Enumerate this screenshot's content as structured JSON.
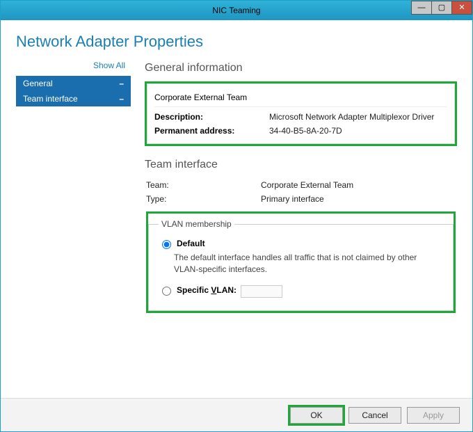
{
  "window": {
    "title": "NIC Teaming"
  },
  "page": {
    "title": "Network Adapter Properties"
  },
  "sidebar": {
    "show_all": "Show All",
    "items": [
      {
        "label": "General",
        "badge": "–"
      },
      {
        "label": "Team interface",
        "badge": "–"
      }
    ]
  },
  "general": {
    "heading": "General information",
    "name": "Corporate External Team",
    "description_label": "Description:",
    "description_value": "Microsoft Network Adapter Multiplexor Driver",
    "perm_addr_label": "Permanent address:",
    "perm_addr_value": "34-40-B5-8A-20-7D"
  },
  "team_interface": {
    "heading": "Team interface",
    "team_label": "Team:",
    "team_value": "Corporate External Team",
    "type_label": "Type:",
    "type_value": "Primary interface"
  },
  "vlan": {
    "legend": "VLAN membership",
    "default_label": "Default",
    "default_desc": "The default interface handles all traffic that is not claimed by other VLAN-specific interfaces.",
    "specific_prefix": "Specific ",
    "specific_v": "V",
    "specific_suffix": "LAN:"
  },
  "buttons": {
    "ok": "OK",
    "cancel": "Cancel",
    "apply": "Apply"
  }
}
